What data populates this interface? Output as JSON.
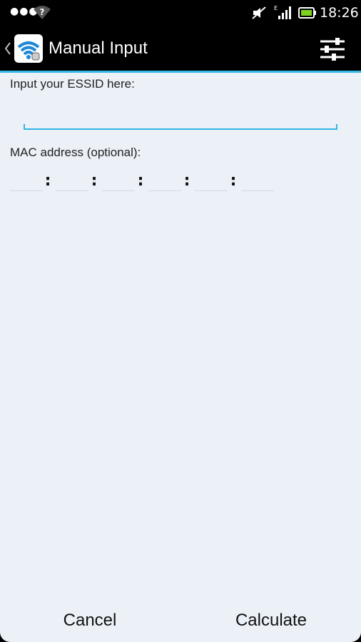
{
  "status_bar": {
    "time": "18:26",
    "network_type": "E",
    "icons": [
      "more-dots-icon",
      "wifi-unknown-icon",
      "mute-icon",
      "signal-icon",
      "battery-icon"
    ]
  },
  "action_bar": {
    "title": "Manual Input",
    "icons": [
      "back-chevron-icon",
      "wifi-app-icon",
      "settings-sliders-icon"
    ],
    "accent": "#33b5e5"
  },
  "form": {
    "essid_label": "Input your ESSID here:",
    "essid_value": "",
    "mac_label": "MAC address (optional):",
    "mac_separator": ":",
    "mac_octets": [
      "",
      "",
      "",
      "",
      "",
      ""
    ]
  },
  "buttons": {
    "cancel": "Cancel",
    "calculate": "Calculate"
  }
}
